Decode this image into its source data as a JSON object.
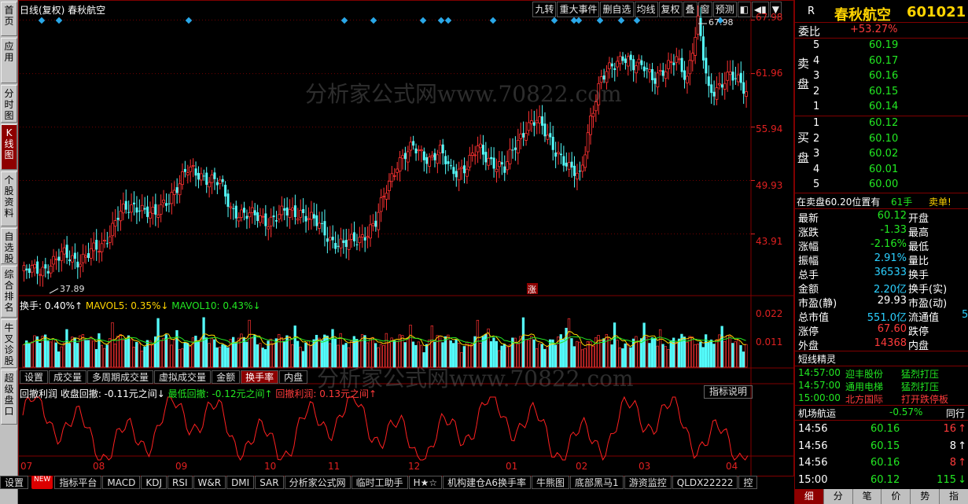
{
  "left_tabs": [
    "首页",
    "应用",
    "分时图",
    "K线图",
    "个股资料",
    "自选股",
    "综合排名",
    "牛叉诊股",
    "超级盘口"
  ],
  "chart_title": "日线(复权)  春秋航空",
  "top_buttons": [
    "九转",
    "重大事件",
    "删自选",
    "均线",
    "复权",
    "叠",
    "窗",
    "预测",
    "◧",
    "◀▮",
    "▼"
  ],
  "price_labels": [
    "67.98",
    "61.96",
    "55.94",
    "49.93",
    "43.91"
  ],
  "high_label": "67.98",
  "low_label": "37.89",
  "zhang_label": "涨",
  "vol_legend": {
    "a": "换手: 0.40%↑",
    "b": "MAVOL5: 0.35%↓",
    "c": "MAVOL10: 0.43%↓"
  },
  "vol_labels": [
    "0.022",
    "0.011"
  ],
  "ind_tabs": [
    "设置",
    "成交量",
    "多周期成交量",
    "虚拟成交量",
    "金额",
    "换手率",
    "内盘"
  ],
  "ind_legend": {
    "a": "回撤利润 收盘回撤: -0.11元之间↓",
    "b": "最低回撤: -0.12元之间↑",
    "c": "回撤利润: 0.13元之间↑"
  },
  "ind_button": "指标说明",
  "months": [
    "07",
    "08",
    "09",
    "10",
    "11",
    "12",
    "01",
    "02",
    "03",
    "04"
  ],
  "bottom_tabs": [
    "设置",
    "NEW",
    "指标平台",
    "MACD",
    "KDJ",
    "RSI",
    "W&R",
    "DMI",
    "SAR",
    "分析家公式网",
    "临时工助手",
    "H★☆",
    "机构建仓A6换手率",
    "牛熊图",
    "底部黑马1",
    "游资监控",
    "QLDX22222",
    "控"
  ],
  "watermark": "分析家公式网www.70822.com",
  "right": {
    "r": "R",
    "name": "春秋航空",
    "code": "601021",
    "weibi_label": "委比",
    "weibi": "+53.27%",
    "sell_label": "卖盘",
    "buy_label": "买盘",
    "sell": [
      {
        "n": "5",
        "p": "60.19"
      },
      {
        "n": "4",
        "p": "60.17"
      },
      {
        "n": "3",
        "p": "60.16"
      },
      {
        "n": "2",
        "p": "60.15"
      },
      {
        "n": "1",
        "p": "60.14"
      }
    ],
    "buy": [
      {
        "n": "1",
        "p": "60.12"
      },
      {
        "n": "2",
        "p": "60.10"
      },
      {
        "n": "3",
        "p": "60.02"
      },
      {
        "n": "4",
        "p": "60.01"
      },
      {
        "n": "5",
        "p": "60.00"
      }
    ],
    "sell_info_a": "在卖盘60.20位置有",
    "sell_info_b": "61手",
    "sell_info_c": "卖单!",
    "stats": [
      {
        "l": "最新",
        "v": "60.12",
        "r": "开盘",
        "cls": "gr"
      },
      {
        "l": "涨跌",
        "v": "-1.33",
        "r": "最高",
        "cls": "gr"
      },
      {
        "l": "涨幅",
        "v": "-2.16%",
        "r": "最低",
        "cls": "gr"
      },
      {
        "l": "振幅",
        "v": "2.91%",
        "r": "量比",
        "cls": "cy"
      },
      {
        "l": "总手",
        "v": "36533",
        "r": "换手",
        "cls": "cy"
      },
      {
        "l": "金额",
        "v": "2.20亿",
        "r": "换手(实)",
        "cls": "cy"
      },
      {
        "l": "市盈(静)",
        "v": "29.93",
        "r": "市盈(动)",
        "cls": "wt"
      },
      {
        "l": "总市值",
        "v": "551.0亿",
        "r": "流通值",
        "cls": "cy"
      },
      {
        "l": "涨停",
        "v": "67.60",
        "r": "跌停",
        "cls": "rd"
      },
      {
        "l": "外盘",
        "v": "14368",
        "r": "内盘",
        "cls": "rd"
      }
    ],
    "stat_extra": "5",
    "elf_title": "短线精灵",
    "elf": [
      {
        "t": "14:57:00",
        "s": "迎丰股份",
        "e": "猛烈打压",
        "c": "gr"
      },
      {
        "t": "14:57:00",
        "s": "通用电梯",
        "e": "猛烈打压",
        "c": "gr"
      },
      {
        "t": "15:00:00",
        "s": "北方国际",
        "e": "打开跌停板",
        "c": "rd"
      }
    ],
    "sector": "机场航运",
    "sector_pct": "-0.57%",
    "sector_btn": "同行",
    "ticks": [
      {
        "t": "14:56",
        "p": "60.16",
        "v": "16",
        "a": "up"
      },
      {
        "t": "14:56",
        "p": "60.15",
        "v": "8",
        "a": "up2"
      },
      {
        "t": "14:56",
        "p": "60.16",
        "v": "8",
        "a": "up"
      },
      {
        "t": "15:00",
        "p": "60.12",
        "v": "115",
        "a": "dn"
      }
    ],
    "bottom_tabs": [
      "细",
      "分",
      "笔",
      "价",
      "势",
      "指"
    ]
  },
  "chart_data": {
    "type": "candlestick",
    "y_labels": [
      67.98,
      61.96,
      55.94,
      49.93,
      43.91
    ],
    "ylim": [
      37.5,
      69
    ],
    "high": 67.98,
    "low": 37.89,
    "x_labels": [
      "07",
      "08",
      "09",
      "10",
      "11",
      "12",
      "01",
      "02",
      "03",
      "04"
    ]
  }
}
